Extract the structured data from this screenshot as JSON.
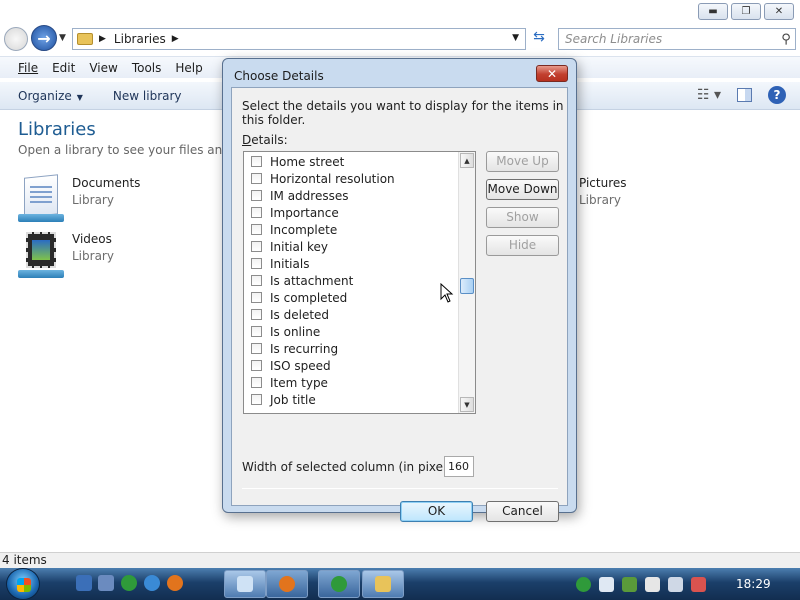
{
  "address_bar": {
    "path": "Libraries",
    "search_placeholder": "Search Libraries"
  },
  "menu": [
    "File",
    "Edit",
    "View",
    "Tools",
    "Help"
  ],
  "toolbar": {
    "organize": "Organize",
    "new_library": "New library"
  },
  "library": {
    "title": "Libraries",
    "subtitle": "Open a library to see your files and arra",
    "items": [
      {
        "name": "Documents",
        "kind": "Library"
      },
      {
        "name": "Videos",
        "kind": "Library"
      },
      {
        "name": "Pictures",
        "kind": "Library"
      }
    ]
  },
  "status": {
    "items": "4 items"
  },
  "taskbar": {
    "clock": "18:29"
  },
  "dialog": {
    "title": "Choose Details",
    "instructions": "Select the details you want to display for the items in this folder.",
    "details_label": "Details:",
    "details": [
      "Home street",
      "Horizontal resolution",
      "IM addresses",
      "Importance",
      "Incomplete",
      "Initial key",
      "Initials",
      "Is attachment",
      "Is completed",
      "Is deleted",
      "Is online",
      "Is recurring",
      "ISO speed",
      "Item type",
      "Job title"
    ],
    "buttons": {
      "move_up": "Move Up",
      "move_down": "Move Down",
      "show": "Show",
      "hide": "Hide",
      "ok": "OK",
      "cancel": "Cancel"
    },
    "width_label": "Width of selected column (in pixels):",
    "width_value": "160"
  }
}
